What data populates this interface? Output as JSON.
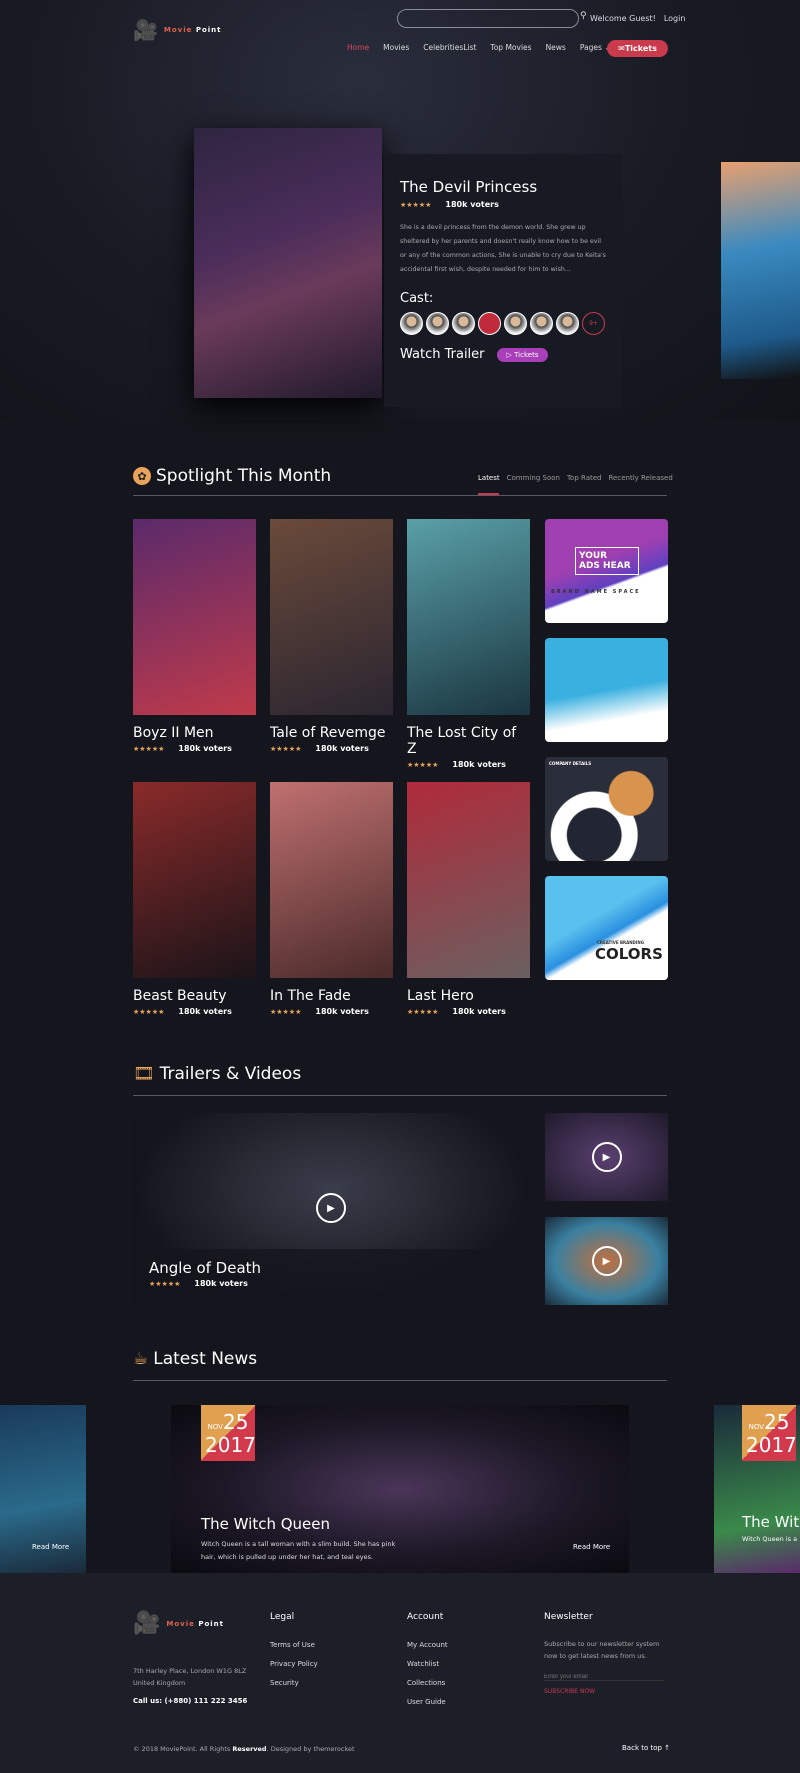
{
  "header": {
    "brand_a": "Movie",
    "brand_b": "Point",
    "search_placeholder": "",
    "welcome": "Welcome Guest!",
    "login": "Login",
    "nav": [
      "Home",
      "Movies",
      "CelebritiesList",
      "Top Movies",
      "News",
      "Pages"
    ],
    "tickets": "Tickets"
  },
  "hero": {
    "title": "The Devil Princess",
    "stars": "★★★★★",
    "voters": "180k voters",
    "description": "She is a devil princess from the demon world. She grew up sheltered by her parents and doesn't really know how to be evil or any of the common actions, She is unable to cry due to Keita's accidental first wish, despite needed for him to wish...",
    "cast_label": "Cast:",
    "cast_more": "9+",
    "watch_trailer": "Watch Trailer",
    "tickets": "▷ Tickets"
  },
  "spotlight": {
    "title": "Spotlight This Month",
    "tabs": [
      "Latest",
      "Comming Soon",
      "Top Rated",
      "Recently Released"
    ],
    "movies": [
      {
        "title": "Boyz II Men",
        "stars": "★★★★★",
        "voters": "180k voters",
        "colors": [
          "#5a2a6a",
          "#c03a4a"
        ]
      },
      {
        "title": "Tale of Revemge",
        "stars": "★★★★★",
        "voters": "180k voters",
        "colors": [
          "#6a4a3a",
          "#2a2530"
        ]
      },
      {
        "title": "The Lost City of Z",
        "stars": "★★★★★",
        "voters": "180k voters",
        "colors": [
          "#5aa0a8",
          "#1a3540"
        ]
      },
      {
        "title": "Beast Beauty",
        "stars": "★★★★★",
        "voters": "180k voters",
        "colors": [
          "#8a2a2a",
          "#1a1418"
        ]
      },
      {
        "title": "In The Fade",
        "stars": "★★★★★",
        "voters": "180k voters",
        "colors": [
          "#c07070",
          "#4a2a2a"
        ]
      },
      {
        "title": "Last Hero",
        "stars": "★★★★★",
        "voters": "180k voters",
        "colors": [
          "#b02a3a",
          "#6a6060"
        ]
      }
    ],
    "ads": [
      {
        "line1": "YOUR",
        "line2": "ADS HEAR",
        "sub": "BRAND NAME SPACE"
      },
      {
        "line1": "",
        "line2": "",
        "sub": ""
      },
      {
        "line1": "",
        "line2": "",
        "sub": "COMPANY DETAILS"
      },
      {
        "line1": "",
        "line2": "COLORS",
        "sub": "CREATIVE BRANDING"
      }
    ]
  },
  "trailers": {
    "title": "Trailers & Videos",
    "main": {
      "title": "Angle of Death",
      "stars": "★★★★★",
      "voters": "180k voters"
    }
  },
  "news": {
    "title": "Latest News",
    "item": {
      "month": "NOV",
      "day": "25",
      "year": "2017",
      "title": "The Witch Queen",
      "text": "Witch Queen is a tall woman with a slim build. She has pink hair, which is pulled up under her hat, and teal eyes.",
      "read_more": "Read More"
    },
    "peek_left_read_more": "Read More",
    "peek_right": {
      "month": "NOV",
      "day": "25",
      "year": "2017",
      "title": "The Witc",
      "text": "Witch Queen is a"
    }
  },
  "footer": {
    "address1": "7th Harley Place, London W1G 8LZ",
    "address2": "United Kingdom",
    "call": "Call us: (+880) 111 222 3456",
    "legal": {
      "title": "Legal",
      "links": [
        "Terms of Use",
        "Privacy Policy",
        "Security"
      ]
    },
    "account": {
      "title": "Account",
      "links": [
        "My Account",
        "Watchlist",
        "Collections",
        "User Guide"
      ]
    },
    "newsletter": {
      "title": "Newsletter",
      "text": "Subscribe to our newsletter system now to get latest news from us.",
      "placeholder": "Enter your email",
      "subscribe": "SUBSCRIBE NOW"
    },
    "copyright_a": "© 2018 MoviePoint. All Rights ",
    "copyright_b": "Reserved",
    "copyright_c": ". Designed by themerocket",
    "back_to_top": "Back to top ↑"
  },
  "colors": {
    "accent": "#c93a4c",
    "star": "#e8a35c",
    "bg": "#15161d"
  }
}
